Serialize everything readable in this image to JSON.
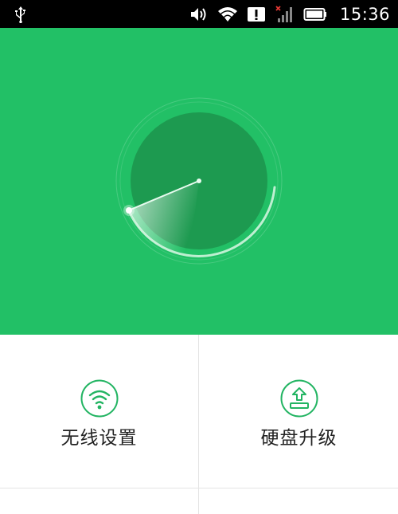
{
  "status_bar": {
    "time": "15:36",
    "icons": [
      "usb-icon",
      "volume-icon",
      "wifi-icon",
      "alert-icon",
      "signal-no-sim-icon",
      "battery-icon"
    ]
  },
  "hero": {
    "background": "#22c066",
    "dial_color": "#1c9a4f",
    "icon": "radar-scan-icon"
  },
  "menu": {
    "items": [
      {
        "label": "无线设置",
        "icon": "wifi-icon"
      },
      {
        "label": "硬盘升级",
        "icon": "upload-icon"
      }
    ]
  },
  "colors": {
    "accent": "#22b462"
  }
}
